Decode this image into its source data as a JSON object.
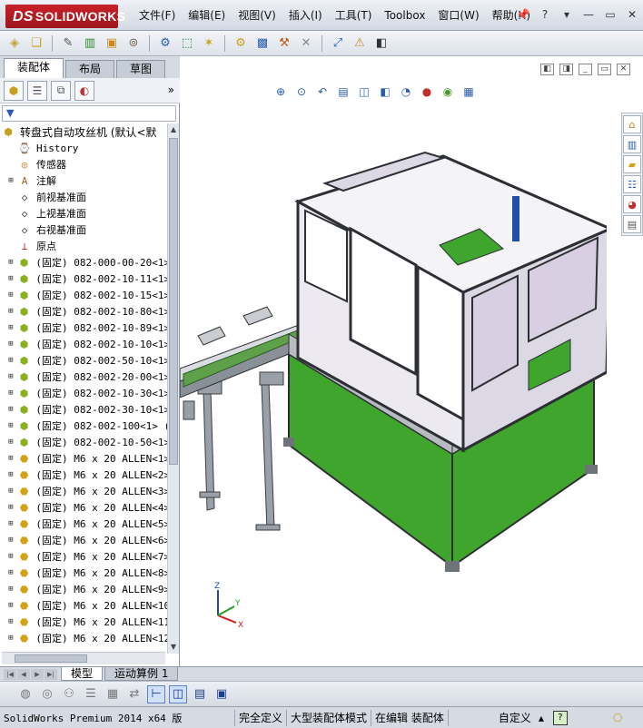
{
  "app": {
    "logo_text": "SOLIDWORKS",
    "logo_prefix": "DS"
  },
  "menu": [
    "文件(F)",
    "编辑(E)",
    "视图(V)",
    "插入(I)",
    "工具(T)",
    "Toolbox",
    "窗口(W)",
    "帮助(H)"
  ],
  "title_controls": {
    "pin": "📌",
    "help": "?",
    "minimize": "—",
    "restore": "▭",
    "close": "✕"
  },
  "toolbar_icons": [
    "new-part-icon",
    "open-icon",
    "paperclip-icon",
    "component-icon",
    "assembly-icon",
    "mate-icon",
    "pattern-icon",
    "move-icon",
    "explode-icon",
    "sketch-icon",
    "smart-fastener-icon",
    "measure-icon",
    "reference-icon",
    "rebuild-icon",
    "options-icon"
  ],
  "left_tabs": [
    "装配体",
    "布局",
    "草图"
  ],
  "filter_symbol": "▼",
  "tree": {
    "root": "转盘式自动攻丝机  (默认<默",
    "features": [
      "History",
      "传感器",
      "注解",
      "前视基准面",
      "上视基准面",
      "右视基准面",
      "原点"
    ],
    "components": [
      "(固定) 082-000-00-20<1>",
      "(固定) 082-002-10-11<1>",
      "(固定) 082-002-10-15<1>",
      "(固定) 082-002-10-80<1>",
      "(固定) 082-002-10-89<1>",
      "(固定) 082-002-10-10<1>",
      "(固定) 082-002-50-10<1>",
      "(固定) 082-002-20-00<1>",
      "(固定) 082-002-10-30<1>",
      "(固定) 082-002-30-10<1>",
      "(固定) 082-002-100<1> (",
      "(固定) 082-002-10-50<1>",
      "(固定) M6 x 20 ALLEN<1>",
      "(固定) M6 x 20 ALLEN<2>",
      "(固定) M6 x 20 ALLEN<3>",
      "(固定) M6 x 20 ALLEN<4>",
      "(固定) M6 x 20 ALLEN<5>",
      "(固定) M6 x 20 ALLEN<6>",
      "(固定) M6 x 20 ALLEN<7>",
      "(固定) M6 x 20 ALLEN<8>",
      "(固定) M6 x 20 ALLEN<9>",
      "(固定) M6 x 20 ALLEN<10",
      "(固定) M6 x 20 ALLEN<11",
      "(固定) M6 x 20 ALLEN<12"
    ]
  },
  "bottom_tabs": [
    "模型",
    "运动算例 1"
  ],
  "triad": {
    "x": "X",
    "y": "Y",
    "z": "Z"
  },
  "status": {
    "version": "SolidWorks Premium 2014 x64 版",
    "state": "完全定义",
    "mode": "大型装配体模式",
    "editing": "在编辑 装配体",
    "units": "自定义",
    "help": "?"
  },
  "colors": {
    "frame": "#3c3f44",
    "panel": "#dcd8e4",
    "base_green": "#3fa52c",
    "accent_blue": "#1f4da8"
  }
}
